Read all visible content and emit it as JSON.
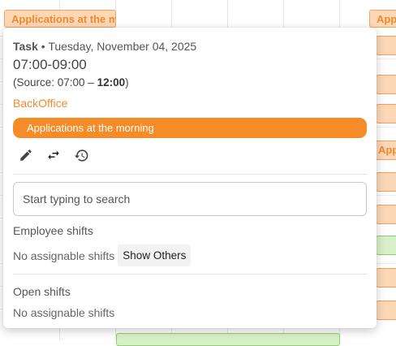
{
  "background": {
    "chips": [
      {
        "label": "Applications at the m",
        "color": "orange"
      },
      {
        "label": "App",
        "color": "orange"
      },
      {
        "label": "App",
        "color": "orange"
      }
    ]
  },
  "popup": {
    "kind": "Task",
    "separator": "•",
    "date": "Tuesday, November 04, 2025",
    "time_range": "07:00-09:00",
    "source_prefix": "(Source: 07:00 – ",
    "source_end": "12:00",
    "source_suffix": ")",
    "department": "BackOffice",
    "task_label": "Applications at the morning",
    "actions": [
      {
        "name": "edit",
        "icon": "pencil-icon"
      },
      {
        "name": "swap",
        "icon": "swap-arrows-icon"
      },
      {
        "name": "history",
        "icon": "history-icon"
      }
    ],
    "search": {
      "placeholder": "Start typing to search",
      "value": ""
    },
    "employee_shifts": {
      "title": "Employee shifts",
      "empty_text": "No assignable shifts",
      "show_others_label": "Show Others"
    },
    "open_shifts": {
      "title": "Open shifts",
      "empty_text": "No assignable shifts"
    }
  },
  "colors": {
    "accent": "#f68c28",
    "department_text": "#f08a2c",
    "chip_orange_bg": "#fcd8b7",
    "chip_green_bg": "#d8f0c8"
  }
}
